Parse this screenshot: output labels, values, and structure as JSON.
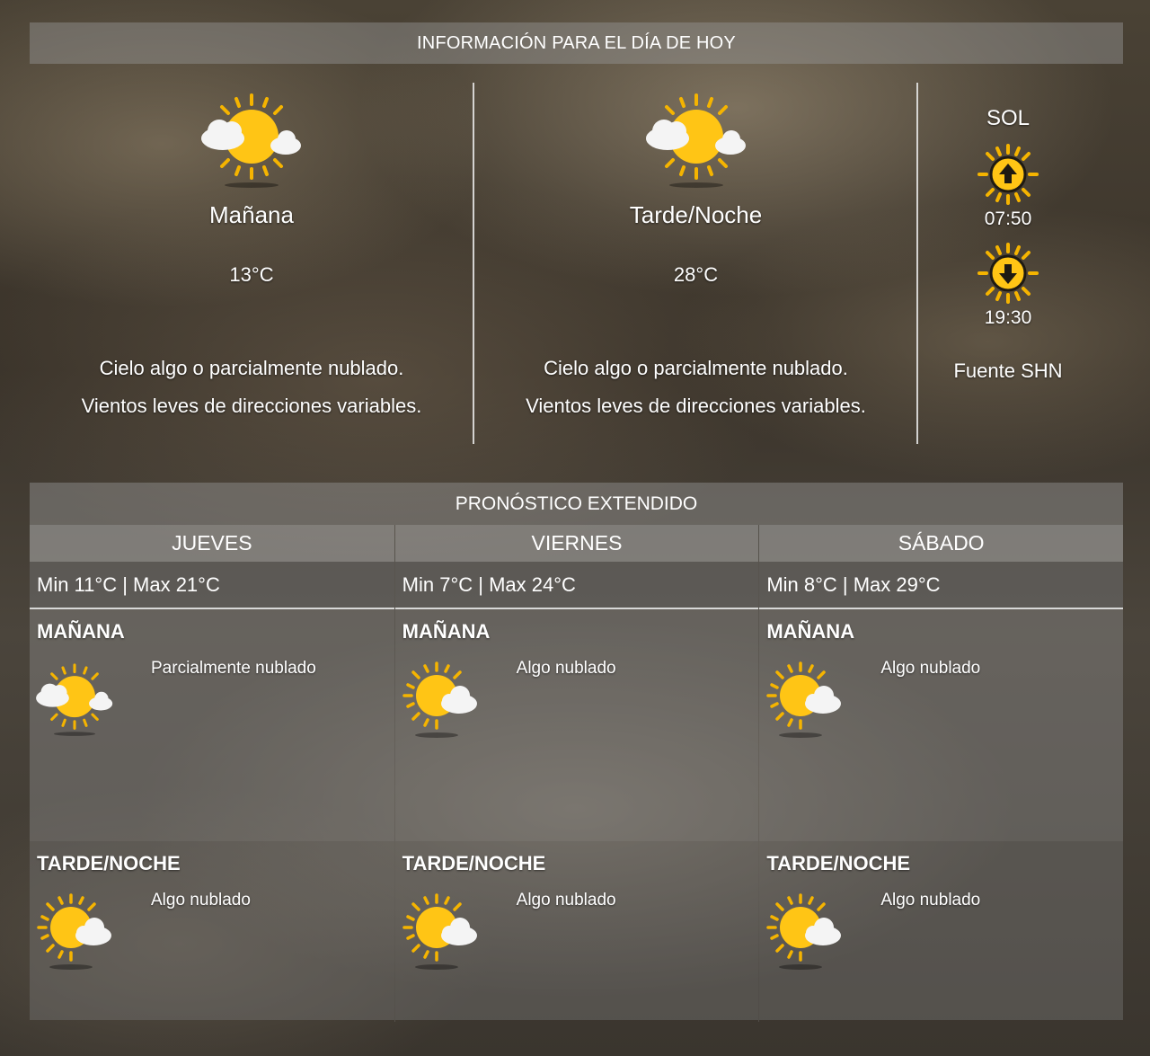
{
  "today": {
    "header": "INFORMACIÓN PARA EL DÍA DE HOY",
    "morning": {
      "title": "Mañana",
      "temp": "13°C",
      "desc_line1": "Cielo algo o parcialmente nublado.",
      "desc_line2": "Vientos leves de direcciones variables.",
      "icon": "sun-behind-clouds-icon"
    },
    "evening": {
      "title": "Tarde/Noche",
      "temp": "28°C",
      "desc_line1": "Cielo algo o parcialmente nublado.",
      "desc_line2": "Vientos leves de direcciones variables.",
      "icon": "sun-behind-clouds-icon"
    },
    "sun": {
      "title": "SOL",
      "sunrise": "07:50",
      "sunset": "19:30",
      "source": "Fuente SHN",
      "sunrise_icon": "sunrise-icon",
      "sunset_icon": "sunset-icon"
    }
  },
  "extended": {
    "header": "PRONÓSTICO EXTENDIDO",
    "days": [
      {
        "name": "JUEVES",
        "minmax": "Min 11°C | Max 21°C",
        "morning": {
          "label": "MAÑANA",
          "desc": "Parcialmente nublado",
          "icon": "sun-behind-clouds-icon"
        },
        "evening": {
          "label": "TARDE/NOCHE",
          "desc": "Algo nublado",
          "icon": "sun-small-cloud-icon"
        }
      },
      {
        "name": "VIERNES",
        "minmax": "Min 7°C | Max 24°C",
        "morning": {
          "label": "MAÑANA",
          "desc": "Algo nublado",
          "icon": "sun-small-cloud-icon"
        },
        "evening": {
          "label": "TARDE/NOCHE",
          "desc": "Algo nublado",
          "icon": "sun-small-cloud-icon"
        }
      },
      {
        "name": "SÁBADO",
        "minmax": "Min 8°C | Max 29°C",
        "morning": {
          "label": "MAÑANA",
          "desc": "Algo nublado",
          "icon": "sun-small-cloud-icon"
        },
        "evening": {
          "label": "TARDE/NOCHE",
          "desc": "Algo nublado",
          "icon": "sun-small-cloud-icon"
        }
      }
    ]
  },
  "colors": {
    "sun": "#ffc515",
    "sun_ray": "#f5b400",
    "cloud": "#f2f2f2"
  }
}
